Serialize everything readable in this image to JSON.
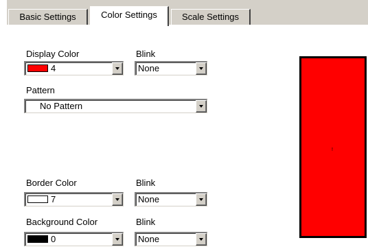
{
  "tabs": [
    {
      "label": "Basic Settings"
    },
    {
      "label": "Color Settings"
    },
    {
      "label": "Scale Settings"
    }
  ],
  "display_color": {
    "label": "Display Color",
    "value": "4",
    "swatch": "#ff0000"
  },
  "display_blink": {
    "label": "Blink",
    "value": "None"
  },
  "pattern": {
    "label": "Pattern",
    "value": "No Pattern"
  },
  "border_color": {
    "label": "Border Color",
    "value": "7",
    "swatch": "#ffffff"
  },
  "border_blink": {
    "label": "Blink",
    "value": "None"
  },
  "background_color": {
    "label": "Background Color",
    "value": "0",
    "swatch": "#000000"
  },
  "background_blink": {
    "label": "Blink",
    "value": "None"
  },
  "preview": {
    "fill": "#ff0000",
    "border": "#000000",
    "marker": "!"
  }
}
